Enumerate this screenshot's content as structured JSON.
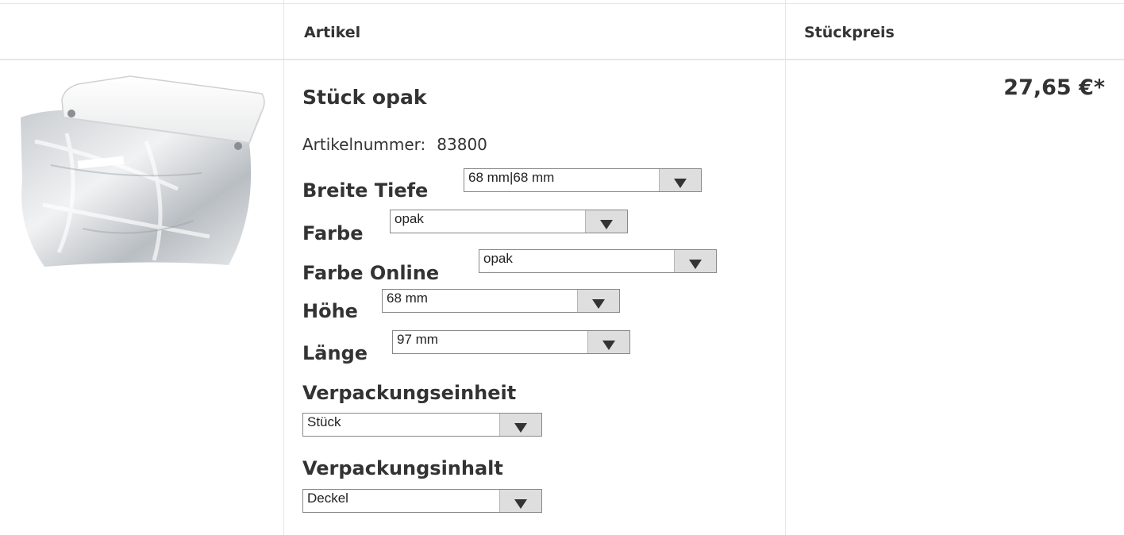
{
  "header": {
    "col_article": "Artikel",
    "col_unit_price": "Stückpreis"
  },
  "product": {
    "title": "Stück opak",
    "article_number_label": "Artikelnummer:",
    "article_number": "83800",
    "price": "27,65 €*",
    "image_icon": "product-photo-lid-in-bag"
  },
  "options": [
    {
      "label": "Breite Tiefe",
      "value": "68 mm|68 mm"
    },
    {
      "label": "Farbe",
      "value": "opak"
    },
    {
      "label": "Farbe Online",
      "value": "opak"
    },
    {
      "label": "Höhe",
      "value": "68 mm"
    },
    {
      "label": "Länge",
      "value": "97 mm"
    },
    {
      "label": "Verpackungseinheit",
      "value": "Stück"
    },
    {
      "label": "Verpackungsinhalt",
      "value": "Deckel"
    }
  ]
}
